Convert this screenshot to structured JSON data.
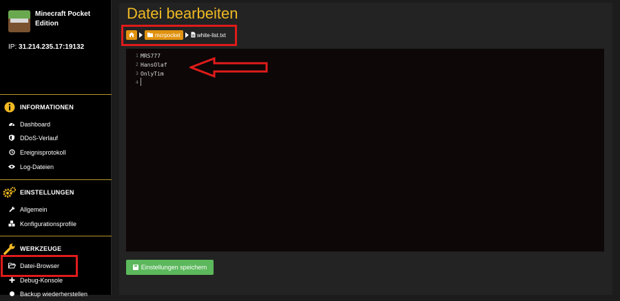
{
  "server": {
    "name": "Minecraft Pocket Edition",
    "ip_label": "IP:",
    "ip_value": "31.214.235.17:19132"
  },
  "sidebar": {
    "sections": [
      {
        "label": "INFORMATIONEN",
        "icon": "info-icon",
        "items": [
          {
            "label": "Dashboard",
            "icon": "dashboard-icon"
          },
          {
            "label": "DDoS-Verlauf",
            "icon": "shield-icon"
          },
          {
            "label": "Ereignisprotokoll",
            "icon": "history-icon"
          },
          {
            "label": "Log-Dateien",
            "icon": "eye-icon"
          }
        ]
      },
      {
        "label": "EINSTELLUNGEN",
        "icon": "cogs-icon",
        "items": [
          {
            "label": "Allgemein",
            "icon": "wrench-icon"
          },
          {
            "label": "Konfigurationsprofile",
            "icon": "cubes-icon"
          }
        ]
      },
      {
        "label": "WERKZEUGE",
        "icon": "wrench-icon",
        "items": [
          {
            "label": "Datei-Browser",
            "icon": "folder-open-icon"
          },
          {
            "label": "Debug-Konsole",
            "icon": "plus-icon"
          },
          {
            "label": "Backup wiederherstellen",
            "icon": "backup-icon"
          }
        ]
      }
    ]
  },
  "main": {
    "title": "Datei bearbeiten",
    "breadcrumb": {
      "home_icon": "home-icon",
      "folder": "mcrpocket",
      "file": "white-list.txt"
    },
    "editor": {
      "line_numbers": [
        "1",
        "2",
        "3",
        "4"
      ],
      "lines": [
        "MRS777",
        "HansOlaf",
        "OnlyTim",
        ""
      ]
    },
    "save_label": "Einstellungen speichern"
  },
  "colors": {
    "accent": "#f0b923",
    "crumb": "#e0920f",
    "save": "#5cb85c",
    "highlight": "#e01b1b"
  }
}
